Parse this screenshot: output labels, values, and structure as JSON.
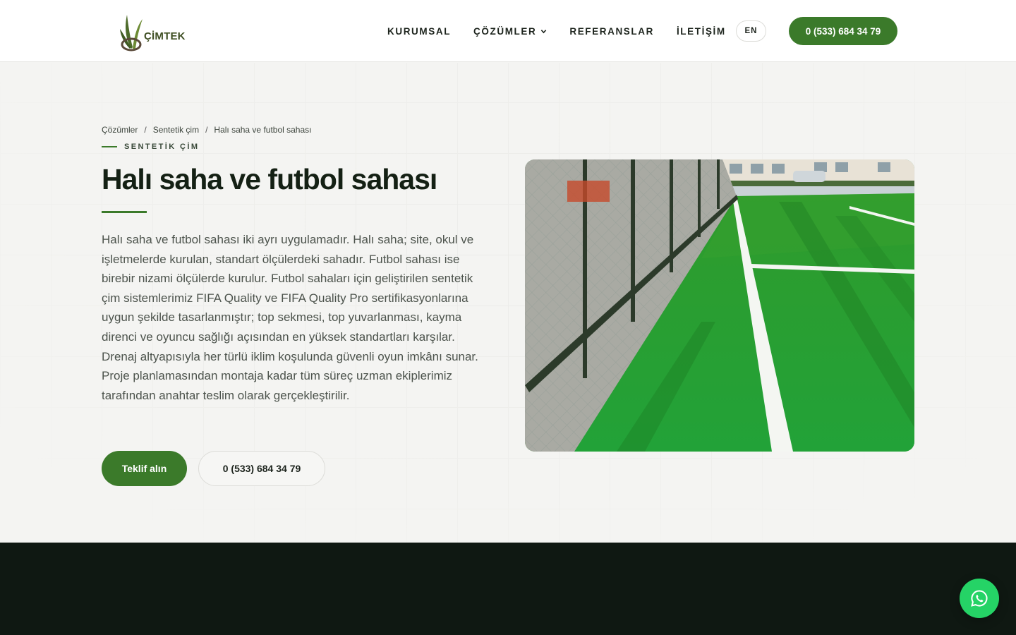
{
  "brand": {
    "name": "ÇİMTEK",
    "accent": "#3b7a2a",
    "dark": "#0f1812",
    "whatsapp": "#25d366"
  },
  "nav": {
    "items": [
      "KURUMSAL",
      "ÇÖZÜMLER",
      "REFERANSLAR",
      "İLETİŞİM"
    ],
    "language": "EN",
    "phone": "0 (533) 684 34 79"
  },
  "breadcrumb": [
    "Çözümler",
    "Sentetik çim",
    "Halı saha ve futbol sahası"
  ],
  "hero": {
    "eyebrow": "SENTETİK ÇİM",
    "title": "Halı saha ve futbol sahası",
    "description": "Halı saha ve futbol sahası iki ayrı uygulamadır. Halı saha; site, okul ve işletmelerde kurulan, standart ölçülerdeki sahadır. Futbol sahası ise birebir nizami ölçülerde kurulur. Futbol sahaları için geliştirilen sentetik çim sistemlerimiz FIFA Quality ve FIFA Quality Pro sertifikasyonlarına uygun şekilde tasarlanmıştır; top sekmesi, top yuvarlanması, kayma direnci ve oyuncu sağlığı açısından en yüksek standartları karşılar. Drenaj altyapısıyla her türlü iklim koşulunda güvenli oyun imkânı sunar. Proje planlamasından montaja kadar tüm süreç uzman ekiplerimiz tarafından anahtar teslim olarak gerçekleştirilir.",
    "cta_primary": "Teklif alın",
    "cta_phone": "0 (533) 684 34 79"
  },
  "icons": {
    "dropdown": "chevron-down-icon",
    "floating": "whatsapp-icon",
    "logo": "grass-leaf-icon"
  }
}
